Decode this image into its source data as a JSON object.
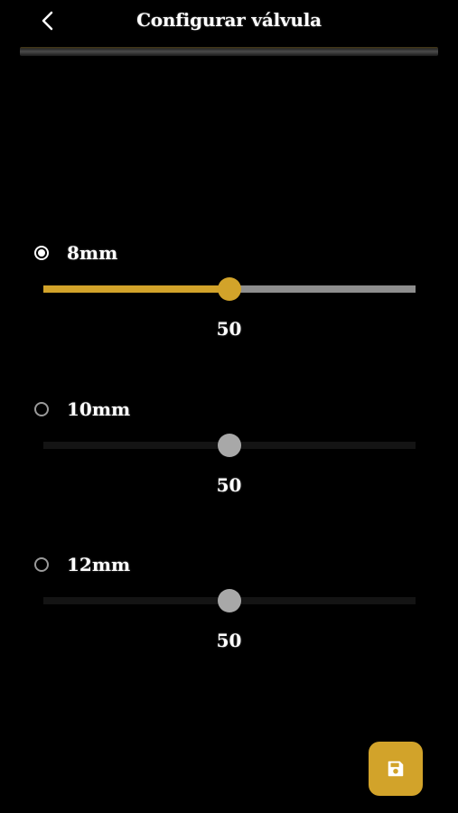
{
  "header": {
    "title": "Configurar válvula",
    "back_icon": "chevron-left-icon"
  },
  "colors": {
    "background": "#000000",
    "accent": "#d2a32a",
    "track_inactive": "#8e8e8e",
    "thumb_disabled": "#a8a8a8"
  },
  "options": [
    {
      "label": "8mm",
      "selected": true,
      "value": 50,
      "value_text": "50",
      "min": 0,
      "max": 100
    },
    {
      "label": "10mm",
      "selected": false,
      "value": 50,
      "value_text": "50",
      "min": 0,
      "max": 100
    },
    {
      "label": "12mm",
      "selected": false,
      "value": 50,
      "value_text": "50",
      "min": 0,
      "max": 100
    }
  ],
  "save_button": {
    "icon": "save-icon"
  }
}
